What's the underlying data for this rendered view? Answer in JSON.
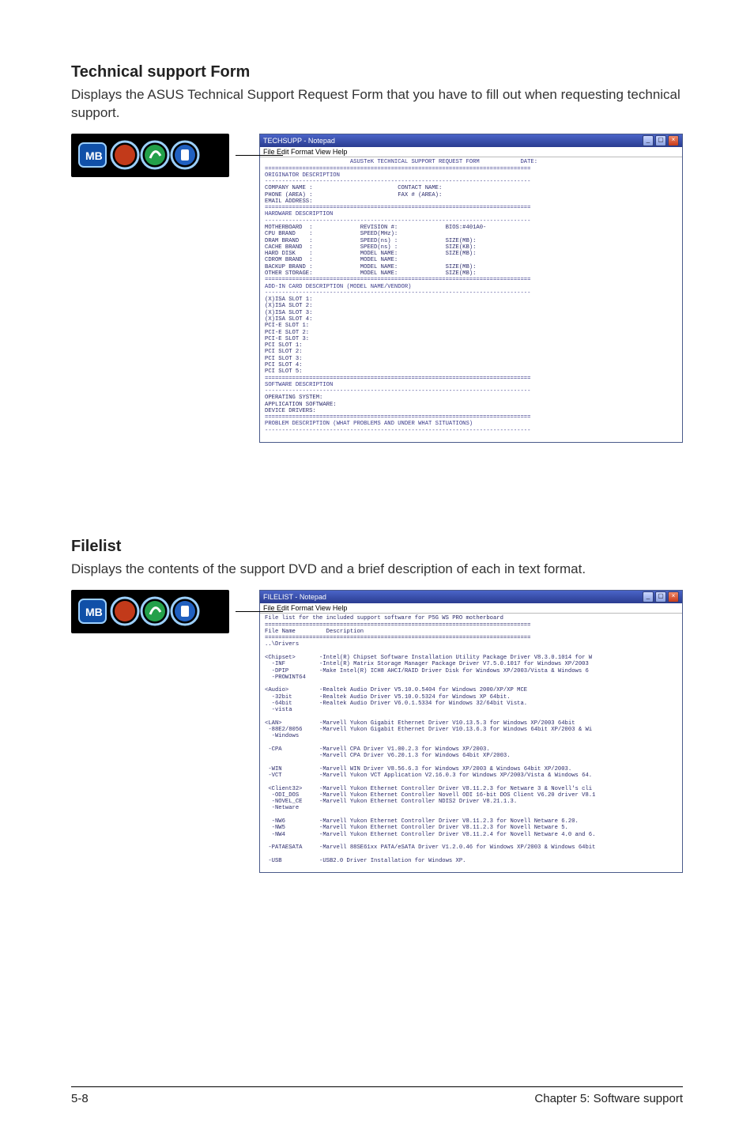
{
  "section1": {
    "title": "Technical support Form",
    "text": "Displays the ASUS Technical Support Request Form that you have to fill out when requesting technical support."
  },
  "section2": {
    "title": "Filelist",
    "text": "Displays the contents of the support DVD and a brief description of each in text format."
  },
  "notepad1": {
    "title": "TECHSUPP - Notepad",
    "menu": "File  Edit  Format  View  Help",
    "heading": "                         ASUSTeK TECHNICAL SUPPORT REQUEST FORM            DATE:",
    "originator": "ORIGINATOR DESCRIPTION",
    "originator_fields": "COMPANY NAME :                         CONTACT NAME:\nPHONE (AREA) :                         FAX # (AREA):\nEMAIL ADDRESS:",
    "hardware": "HARDWARE DESCRIPTION",
    "hardware_fields": "MOTHERBOARD  :              REVISION #:              BIOS:#401A0-\nCPU BRAND    :              SPEED(MHz):\nDRAM BRAND   :              SPEED(ns) :              SIZE(MB):\nCACHE BRAND  :              SPEED(ns) :              SIZE(KB):\nHARD DISK    :              MODEL NAME:              SIZE(MB):\nCDROM BRAND  :              MODEL NAME:\nBACKUP BRAND :              MODEL NAME:              SIZE(MB):\nOTHER STORAGE:              MODEL NAME:              SIZE(MB):",
    "addin": "ADD-IN CARD DESCRIPTION (MODEL NAME/VENDOR)",
    "addin_fields": "(X)ISA SLOT 1:\n(X)ISA SLOT 2:\n(X)ISA SLOT 3:\n(X)ISA SLOT 4:\nPCI-E SLOT 1:\nPCI-E SLOT 2:\nPCI-E SLOT 3:\nPCI SLOT 1:\nPCI SLOT 2:\nPCI SLOT 3:\nPCI SLOT 4:\nPCI SLOT 5:",
    "software": "SOFTWARE DESCRIPTION",
    "software_fields": "OPERATING SYSTEM:\nAPPLICATION SOFTWARE:\nDEVICE DRIVERS:",
    "problem": "PROBLEM DESCRIPTION (WHAT PROBLEMS AND UNDER WHAT SITUATIONS)"
  },
  "notepad2": {
    "title": "FILELIST - Notepad",
    "menu": "File  Edit  Format  View  Help",
    "headline": "File list for the included support software for P5G WS PRO motherboard",
    "col_head": "File Name         Description",
    "blocks": [
      {
        "dir": "..\\Drivers",
        "items": [
          {
            "dir": "<Chipset>\n  -INF\n  -DPIP\n  -PROWINT64",
            "desc": "-Intel(R) Chipset Software Installation Utility Package Driver V8.3.0.1014 for W\n-Intel(R) Matrix Storage Manager Package Driver V7.5.0.1017 for Windows XP/2003\n-Make Intel(R) ICH8 AHCI/RAID Driver Disk for Windows XP/2003/Vista & Windows 6"
          },
          {
            "dir": "<Audio>\n  -32bit\n  -64bit\n  -vista",
            "desc": "-Realtek Audio Driver V5.10.0.5404 for Windows 2000/XP/XP MCE\n-Realtek Audio Driver V5.10.0.5324 for Windows XP 64bit.\n-Realtek Audio Driver V6.0.1.5334 for Windows 32/64bit Vista."
          },
          {
            "dir": "<LAN>\n -88E2/8056\n  -Windows",
            "desc": "-Marvell Yukon Gigabit Ethernet Driver V10.13.5.3 for Windows XP/2003 64bit\n-Marvell Yukon Gigabit Ethernet Driver V10.13.6.3 for Windows 64bit XP/2003 & Wi"
          },
          {
            "dir": " -CPA",
            "desc": "-Marvell CPA Driver V1.00.2.3 for Windows XP/2003.\n-Marvell CPA Driver V6.20.1.3 for Windows 64bit XP/2003."
          },
          {
            "dir": " -WIN\n -VCT",
            "desc": "-Marvell WIN Driver V8.56.6.3 for Windows XP/2003 & Windows 64bit XP/2003.\n-Marvell Yukon VCT Application V2.16.0.3 for Windows XP/2003/Vista & Windows 64."
          },
          {
            "dir": " <Client32>\n  -ODI_DOS\n  -NOVEL_CE\n  -Netware",
            "desc": "-Marvell Yukon Ethernet Controller Driver V8.11.2.3 for Netware 3 & Novell's cli\n-Marvell Yukon Ethernet Controller Novell ODI 16-bit DOS Client V6.20 driver V8.1\n-Marvell Yukon Ethernet Controller NDIS2 Driver V8.21.1.3."
          },
          {
            "dir": "  -NW6\n  -NW5\n  -NW4",
            "desc": "-Marvell Yukon Ethernet Controller Driver V8.11.2.3 for Novell Netware 6.20.\n-Marvell Yukon Ethernet Controller Driver V8.11.2.3 for Novell Netware 5.\n-Marvell Yukon Ethernet Controller Driver V8.11.2.4 for Novell Netware 4.0 and 6."
          },
          {
            "dir": " -PATAESATA",
            "desc": "-Marvell 88SE61xx PATA/eSATA Driver V1.2.0.46 for Windows XP/2003 & Windows 64bit"
          },
          {
            "dir": " -USB",
            "desc": "-USB2.0 Driver Installation for Windows XP."
          }
        ]
      }
    ]
  },
  "footer": {
    "left": "5-8",
    "right": "Chapter 5: Software support"
  }
}
